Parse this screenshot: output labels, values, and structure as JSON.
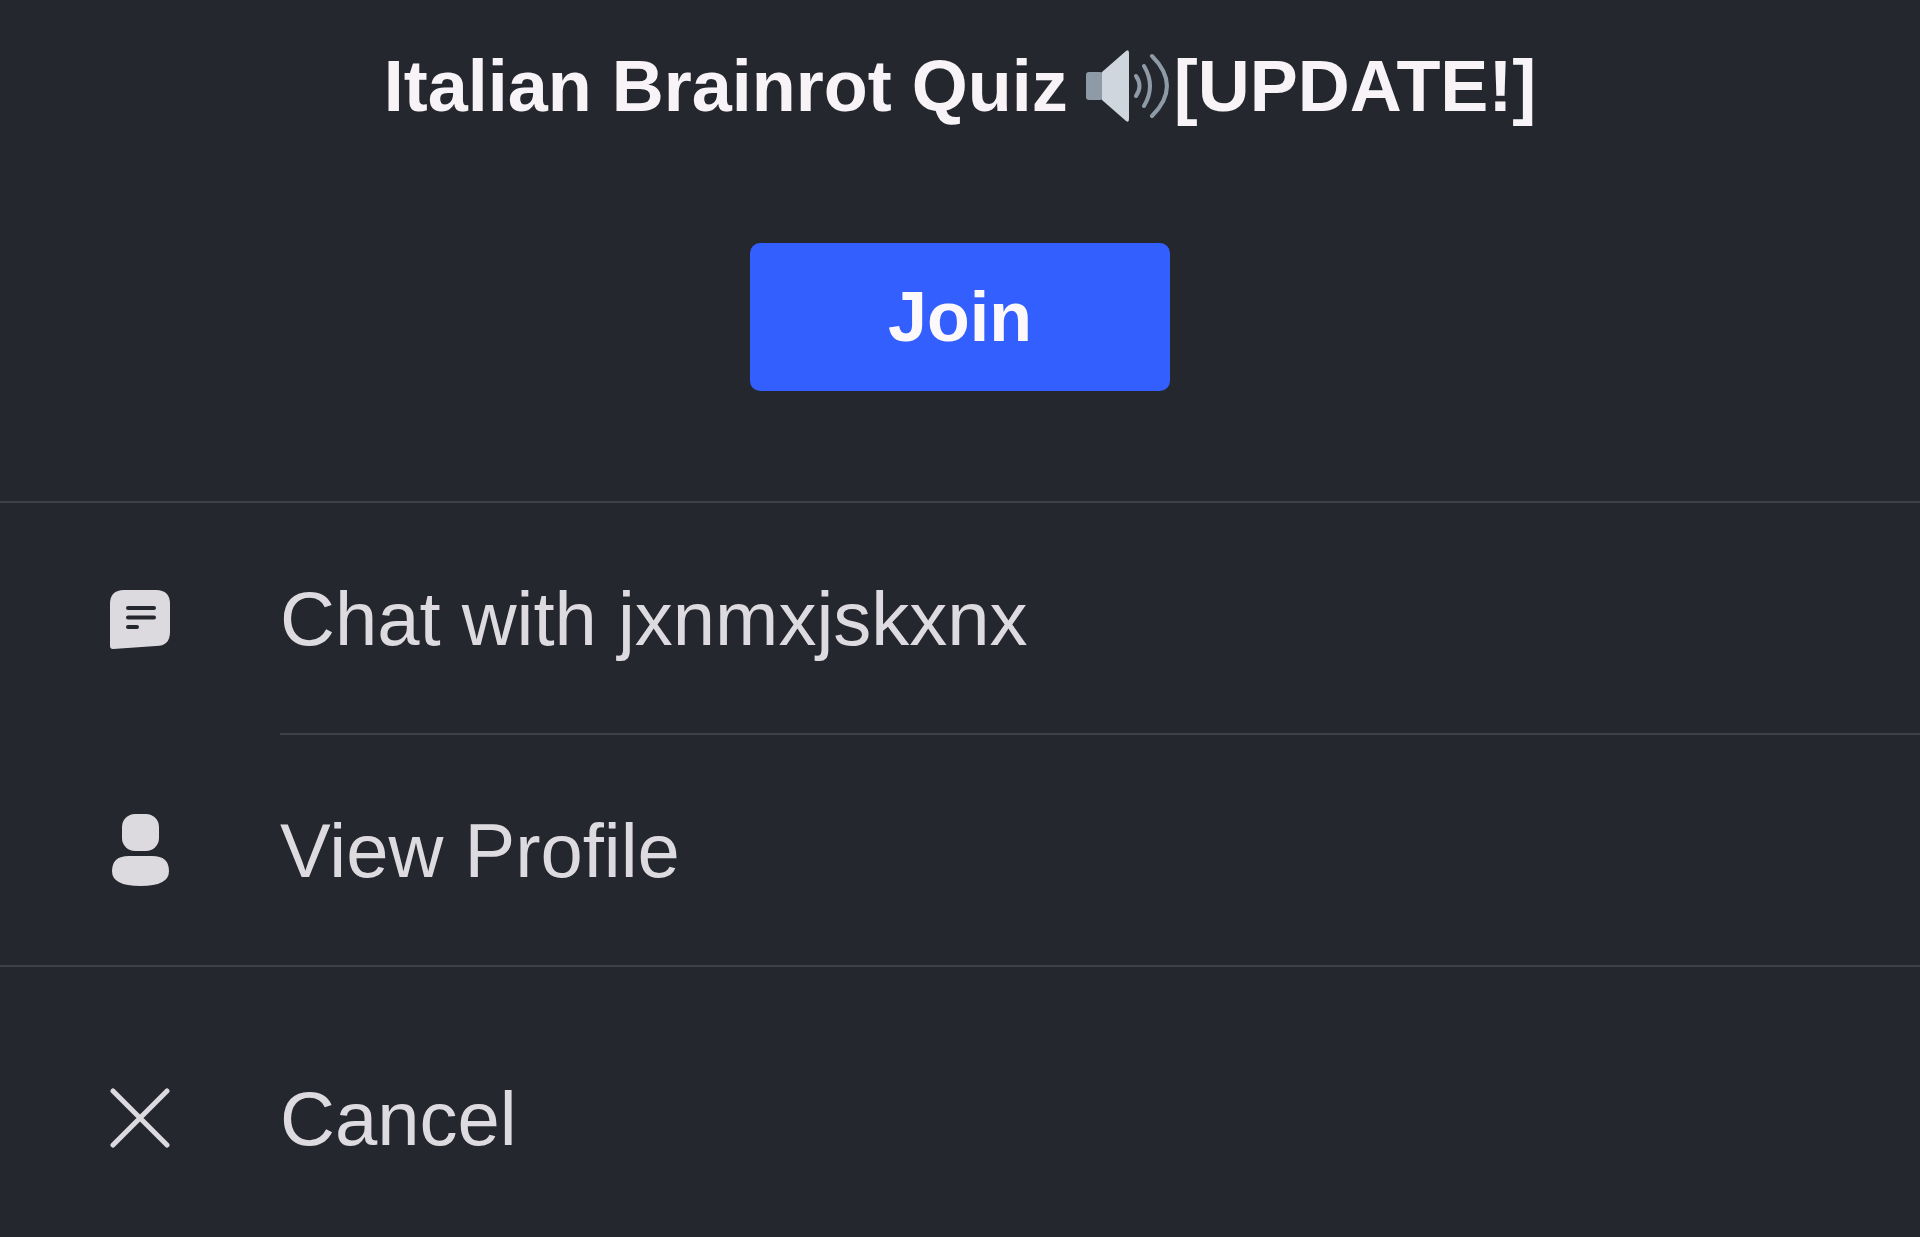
{
  "title": {
    "text": "Italian Brainrot Quiz",
    "tag": "[UPDATE!]"
  },
  "join_button": {
    "label": "Join"
  },
  "menu": {
    "sections": [
      {
        "items": [
          {
            "kind": "chat",
            "label": "Chat with jxnmxjskxnx"
          },
          {
            "kind": "profile",
            "label": "View Profile"
          }
        ]
      },
      {
        "items": [
          {
            "kind": "cancel",
            "label": "Cancel"
          }
        ]
      }
    ]
  }
}
